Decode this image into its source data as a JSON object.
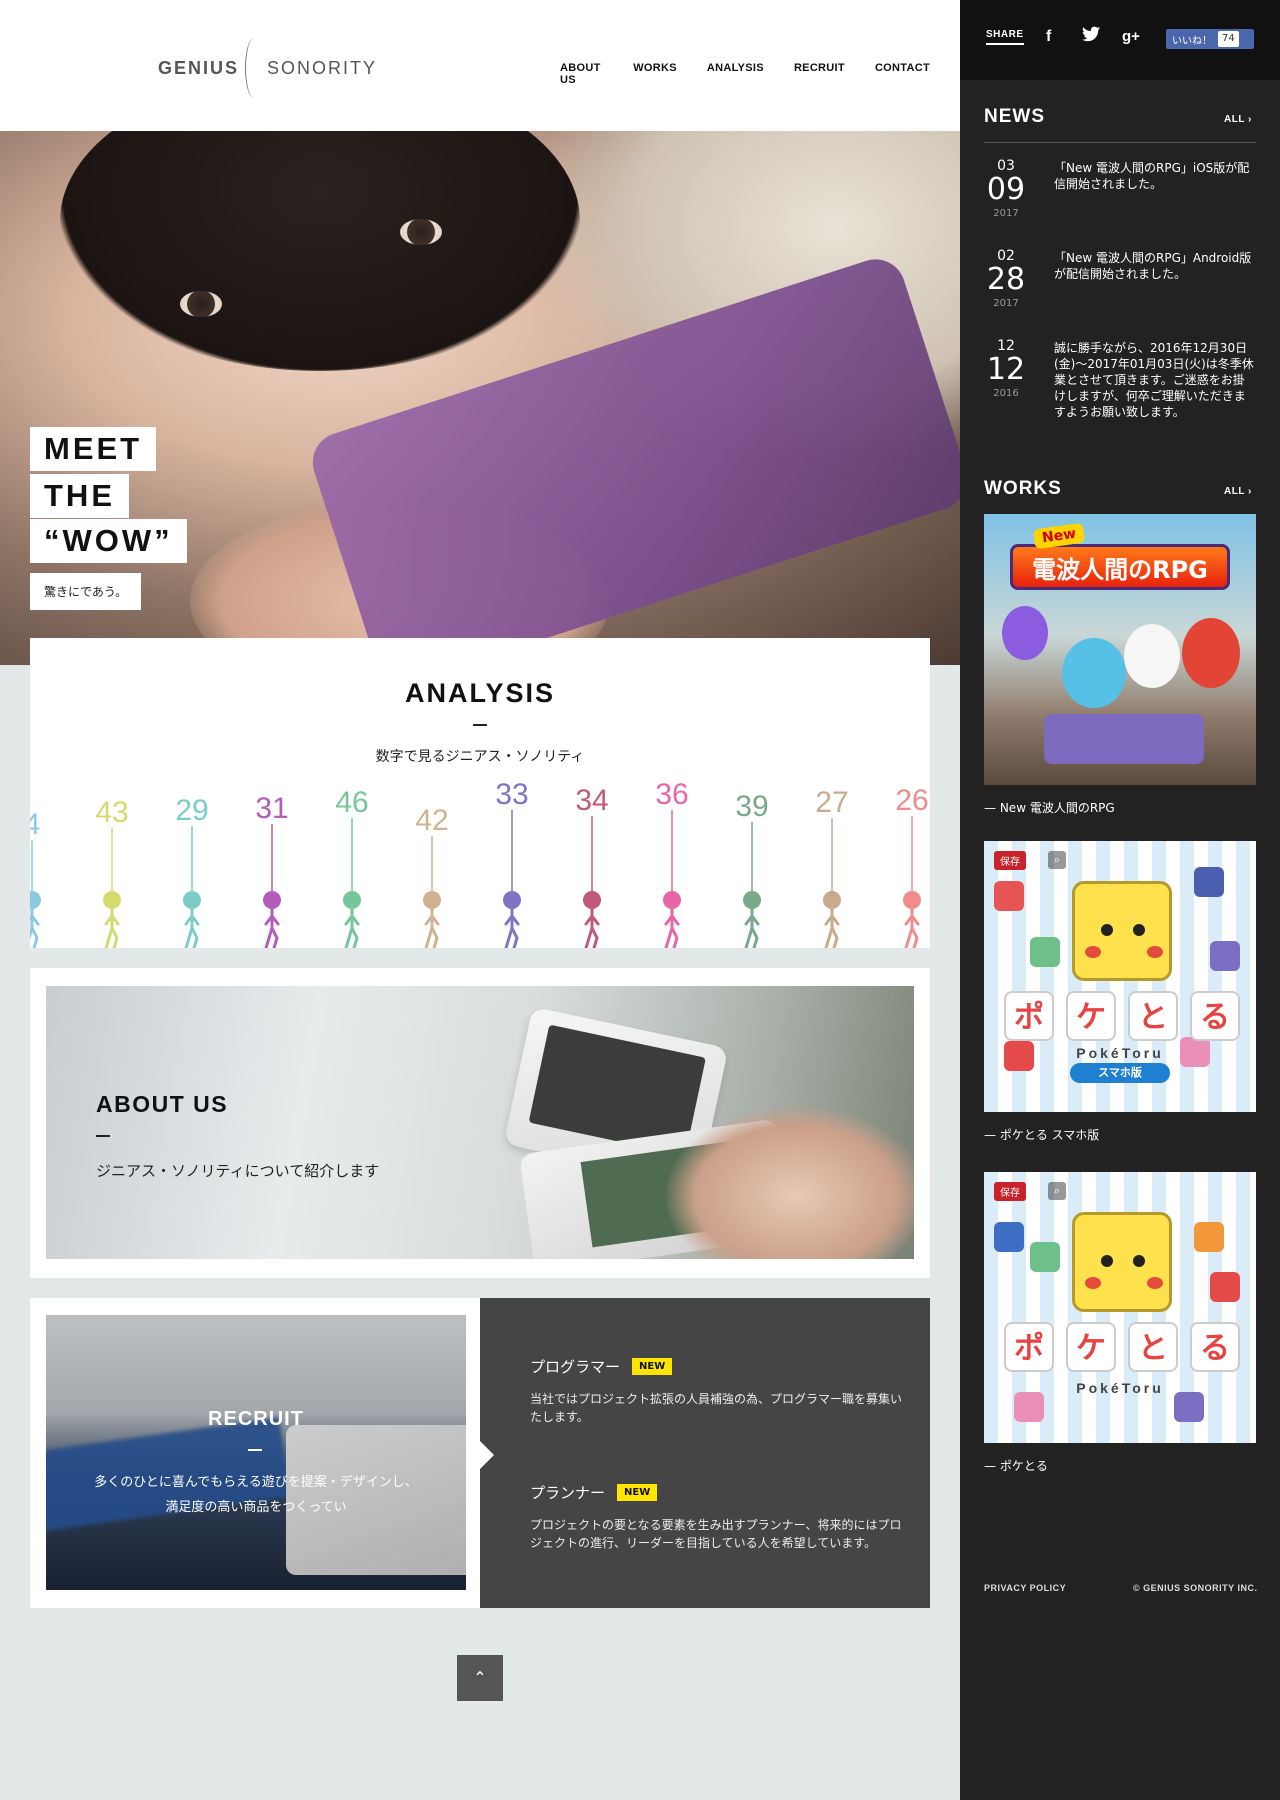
{
  "header": {
    "logo_left": "GENIUS",
    "logo_right": "SONORITY",
    "nav": [
      "ABOUT US",
      "WORKS",
      "ANALYSIS",
      "RECRUIT",
      "CONTACT"
    ]
  },
  "hero": {
    "tag_lines": [
      "MEET",
      "THE",
      "“WOW”"
    ],
    "tag_sub": "驚きにであう。"
  },
  "analysis": {
    "title": "ANALYSIS",
    "subtitle": "数字で見るジニアス・ソノリティ",
    "figures": [
      {
        "value": "4",
        "color": "#8fc9df"
      },
      {
        "value": "43",
        "color": "#d4da6e"
      },
      {
        "value": "29",
        "color": "#7ccdc8"
      },
      {
        "value": "31",
        "color": "#b35dbb"
      },
      {
        "value": "46",
        "color": "#77c59a"
      },
      {
        "value": "42",
        "color": "#cfb391"
      },
      {
        "value": "33",
        "color": "#7f75c4"
      },
      {
        "value": "34",
        "color": "#c15a78"
      },
      {
        "value": "36",
        "color": "#e666a8"
      },
      {
        "value": "39",
        "color": "#7aa98a"
      },
      {
        "value": "27",
        "color": "#c8ab8c"
      },
      {
        "value": "26",
        "color": "#ef8c8c"
      }
    ]
  },
  "about": {
    "title": "ABOUT US",
    "subtitle": "ジニアス・ソノリティについて紹介します"
  },
  "recruit": {
    "title": "RECRUIT",
    "desc_lines": [
      "多くのひとに喜んでもらえる遊びを提案・デザインし、",
      "満足度の高い商品をつくってい"
    ],
    "jobs": [
      {
        "title": "プログラマー",
        "badge": "NEW",
        "desc": "当社ではプロジェクト拡張の人員補強の為、プログラマー職を募集いたします。"
      },
      {
        "title": "プランナー",
        "badge": "NEW",
        "desc": "プロジェクトの要となる要素を生み出すプランナー、将来的にはプロジェクトの進行、リーダーを目指している人を希望しています。"
      }
    ],
    "to_top": "⌃"
  },
  "sidebar": {
    "share_label": "SHARE",
    "share_icons": [
      "f",
      "twitter-bird",
      "g+"
    ],
    "like_label": "いいね！",
    "like_count": "74",
    "news_title": "NEWS",
    "news_all": "ALL",
    "news": [
      {
        "month": "03",
        "day": "09",
        "year": "2017",
        "text": "「New 電波人間のRPG」iOS版が配信開始されました。"
      },
      {
        "month": "02",
        "day": "28",
        "year": "2017",
        "text": "「New 電波人間のRPG」Android版が配信開始されました。"
      },
      {
        "month": "12",
        "day": "12",
        "year": "2016",
        "text": "誠に勝手ながら、2016年12月30日(金)〜2017年01月03日(火)は冬季休業とさせて頂きます。ご迷惑をお掛けしますが、何卒ご理解いただきますようお願い致します。"
      }
    ],
    "works_title": "WORKS",
    "works_all": "ALL",
    "works": [
      {
        "caption": "New 電波人間のRPG",
        "logo_text": "電波人間のRPG",
        "new_text": "New"
      },
      {
        "caption": "ポケとる スマホ版",
        "pin": "保存",
        "brand": "PokéToru",
        "edition": "スマホ版",
        "kana": [
          "ポ",
          "ケ",
          "と",
          "る"
        ]
      },
      {
        "caption": "ポケとる",
        "pin": "保存",
        "brand": "PokéToru",
        "kana": [
          "ポ",
          "ケ",
          "と",
          "る"
        ]
      }
    ],
    "footer_left": "PRIVACY POLICY",
    "footer_right": "© GENIUS SONORITY INC."
  }
}
